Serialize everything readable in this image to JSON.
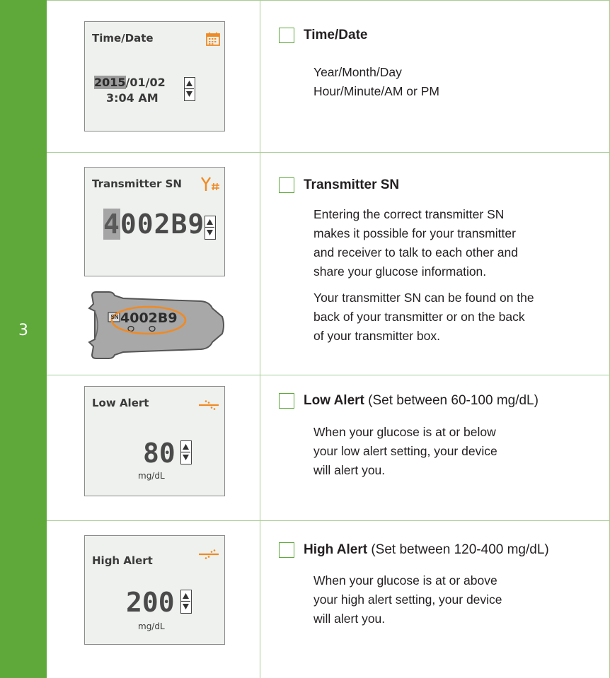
{
  "step": "3",
  "colors": {
    "band": "#5ea93a",
    "accent_orange": "#f08a24",
    "screen_bg": "#eef1ed"
  },
  "rows": {
    "time_date": {
      "screen_title": "Time/Date",
      "year": "2015",
      "rest_of_date": "/01/02",
      "time": "3:04 AM",
      "icon": "calendar-icon",
      "title": "Time/Date",
      "lines": [
        "Year/Month/Day",
        "Hour/Minute/AM or PM"
      ]
    },
    "transmitter_sn": {
      "screen_title": "Transmitter SN",
      "sn_first": "4",
      "sn_rest": "002B9",
      "icon": "antenna-hash-icon",
      "device_badge": "SN",
      "device_sn": "4002B9",
      "title": "Transmitter SN",
      "para1": [
        "Entering the correct transmitter SN",
        "makes it possible for your transmitter",
        "and receiver to talk to each other and",
        "share your glucose information."
      ],
      "para2": [
        "Your transmitter SN can be found on the",
        "back of your transmitter or on the back",
        "of your transmitter box."
      ]
    },
    "low_alert": {
      "screen_title": "Low Alert",
      "value": "80",
      "unit": "mg/dL",
      "icon": "low-alert-icon",
      "title": "Low Alert",
      "note": " (Set between 60-100 mg/dL)",
      "lines": [
        "When your glucose is at or below",
        "your low alert setting, your device",
        "will alert you."
      ]
    },
    "high_alert": {
      "screen_title": "High Alert",
      "value": "200",
      "unit": "mg/dL",
      "icon": "high-alert-icon",
      "title": "High Alert",
      "note": " (Set between 120-400 mg/dL)",
      "lines": [
        "When your glucose is at or above",
        "your high alert setting, your device",
        "will alert you."
      ]
    }
  }
}
